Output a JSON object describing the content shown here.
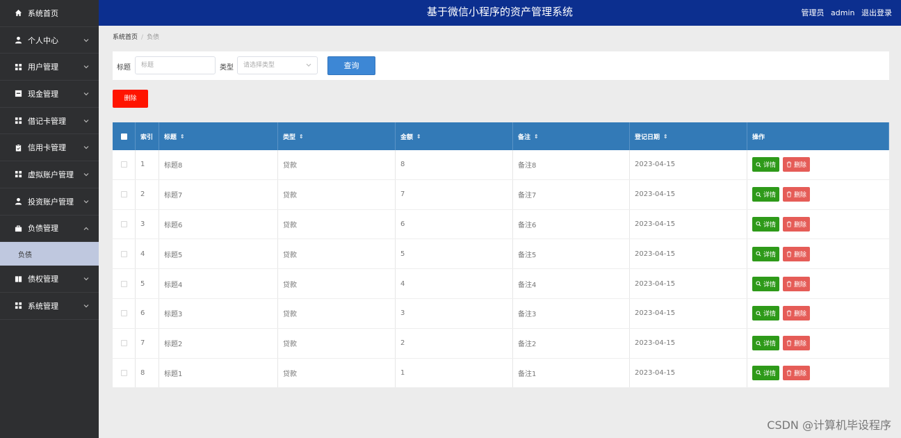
{
  "header": {
    "title": "基于微信小程序的资产管理系统",
    "role": "管理员",
    "user": "admin",
    "logout": "退出登录"
  },
  "sidebar": {
    "items": [
      {
        "label": "系统首页",
        "icon": "home-icon",
        "expandable": false
      },
      {
        "label": "个人中心",
        "icon": "person-icon",
        "expandable": true
      },
      {
        "label": "用户管理",
        "icon": "grid-icon",
        "expandable": true
      },
      {
        "label": "现金管理",
        "icon": "square-icon",
        "expandable": true
      },
      {
        "label": "借记卡管理",
        "icon": "grid-icon",
        "expandable": true
      },
      {
        "label": "信用卡管理",
        "icon": "clipboard-icon",
        "expandable": true
      },
      {
        "label": "虚拟账户管理",
        "icon": "grid-icon",
        "expandable": true
      },
      {
        "label": "投资账户管理",
        "icon": "person-icon",
        "expandable": true
      },
      {
        "label": "负债管理",
        "icon": "briefcase-icon",
        "expandable": true,
        "expanded": true,
        "sub": "负债"
      },
      {
        "label": "债权管理",
        "icon": "book-icon",
        "expandable": true
      },
      {
        "label": "系统管理",
        "icon": "grid-icon",
        "expandable": true
      }
    ]
  },
  "breadcrumb": {
    "home": "系统首页",
    "current": "负债"
  },
  "search": {
    "title_label": "标题",
    "title_placeholder": "标题",
    "type_label": "类型",
    "type_placeholder": "请选择类型",
    "button": "查询"
  },
  "actions": {
    "bulk_delete": "删除"
  },
  "table": {
    "headers": [
      "索引",
      "标题",
      "类型",
      "金额",
      "备注",
      "登记日期",
      "操作"
    ],
    "detail_label": "详情",
    "delete_label": "删除",
    "rows": [
      {
        "index": "1",
        "title": "标题8",
        "type": "贷款",
        "amount": "8",
        "note": "备注8",
        "date": "2023-04-15"
      },
      {
        "index": "2",
        "title": "标题7",
        "type": "贷款",
        "amount": "7",
        "note": "备注7",
        "date": "2023-04-15"
      },
      {
        "index": "3",
        "title": "标题6",
        "type": "贷款",
        "amount": "6",
        "note": "备注6",
        "date": "2023-04-15"
      },
      {
        "index": "4",
        "title": "标题5",
        "type": "贷款",
        "amount": "5",
        "note": "备注5",
        "date": "2023-04-15"
      },
      {
        "index": "5",
        "title": "标题4",
        "type": "贷款",
        "amount": "4",
        "note": "备注4",
        "date": "2023-04-15"
      },
      {
        "index": "6",
        "title": "标题3",
        "type": "贷款",
        "amount": "3",
        "note": "备注3",
        "date": "2023-04-15"
      },
      {
        "index": "7",
        "title": "标题2",
        "type": "贷款",
        "amount": "2",
        "note": "备注2",
        "date": "2023-04-15"
      },
      {
        "index": "8",
        "title": "标题1",
        "type": "贷款",
        "amount": "1",
        "note": "备注1",
        "date": "2023-04-15"
      }
    ]
  },
  "watermark": "CSDN @计算机毕设程序",
  "colors": {
    "header": "#0c2f8f",
    "sidebar": "#2e2f31",
    "table_header": "#337ab7",
    "detail": "#2e9a19",
    "delete": "#e55c57",
    "bulk_delete": "#ff1400"
  }
}
